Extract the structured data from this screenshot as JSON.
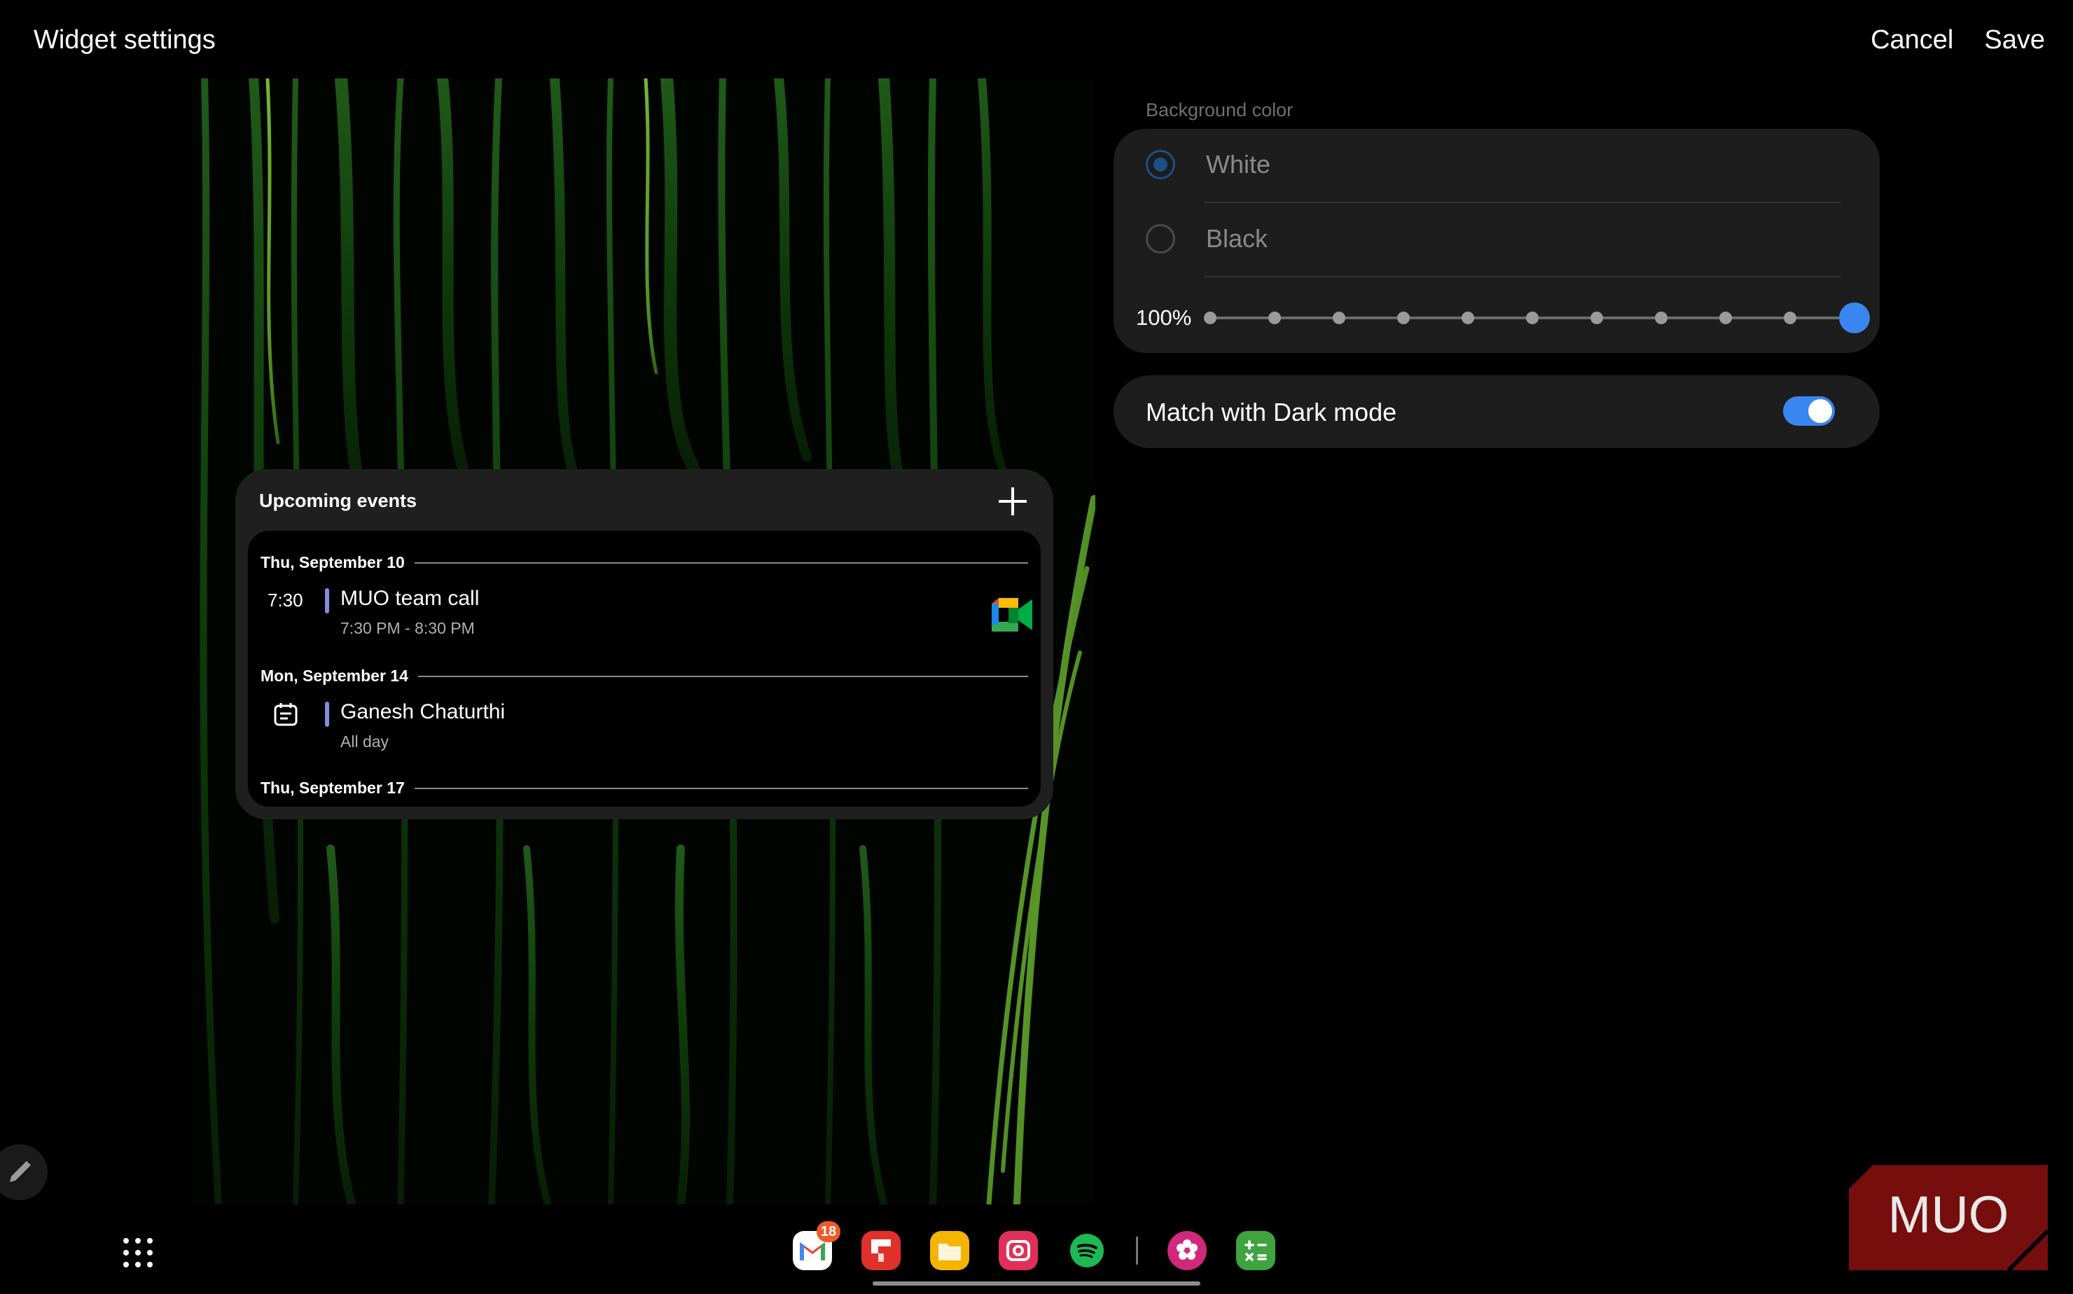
{
  "header": {
    "title": "Widget settings",
    "cancel_label": "Cancel",
    "save_label": "Save"
  },
  "widget": {
    "title": "Upcoming events",
    "add_icon": "plus-icon",
    "days": [
      {
        "date": "Thu, September 10",
        "events": [
          {
            "time": "7:30",
            "title": "MUO team call",
            "subtitle": "7:30 PM - 8:30 PM",
            "icon": "google-meet-icon",
            "bar_color": "#8090e0"
          }
        ]
      },
      {
        "date": "Mon, September 14",
        "events": [
          {
            "icon": "calendar-icon",
            "title": "Ganesh Chaturthi",
            "subtitle": "All day",
            "bar_color": "#8090e0"
          }
        ]
      },
      {
        "date": "Thu, September 17",
        "events": []
      }
    ]
  },
  "settings": {
    "background_color_label": "Background color",
    "options": [
      {
        "label": "White",
        "selected": true
      },
      {
        "label": "Black",
        "selected": false
      }
    ],
    "transparency": {
      "label": "100%",
      "value": 1.0,
      "steps": 11
    },
    "match_dark_mode": {
      "label": "Match with Dark mode",
      "enabled": true
    }
  },
  "dock": {
    "apps_icon": "app-grid-icon",
    "apps": [
      {
        "name": "gmail-icon",
        "color": "#ffffff",
        "badge": "18"
      },
      {
        "name": "flipboard-icon",
        "color": "#e0302a"
      },
      {
        "name": "files-icon",
        "color": "#f4b400"
      },
      {
        "name": "camera-icon",
        "color": "#e0305a"
      },
      {
        "name": "spotify-icon",
        "color": "#1db954"
      },
      {
        "name": "blossom-icon",
        "color": "#d0287a"
      },
      {
        "name": "calculator-icon",
        "color": "#3fa33f"
      }
    ]
  },
  "watermark": {
    "text": "MUO",
    "color": "#8b1010"
  },
  "colors": {
    "accent": "#3a86f0",
    "event_bar": "#8090e0",
    "card": "#1d1d1d"
  }
}
